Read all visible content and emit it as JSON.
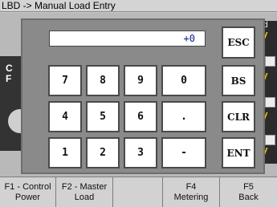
{
  "title_bar": {
    "breadcrumb": "LBD -> Manual Load Entry"
  },
  "background": {
    "left_label_1": "C",
    "left_label_2": "F",
    "right_top_char": "d"
  },
  "keypad": {
    "display_value": "+0",
    "rows": [
      [
        "7",
        "8",
        "9",
        "0"
      ],
      [
        "4",
        "5",
        "6",
        "."
      ],
      [
        "1",
        "2",
        "3",
        "-"
      ]
    ],
    "side_keys": [
      "ESC",
      "BS",
      "CLR",
      "ENT"
    ]
  },
  "function_keys": [
    {
      "key": "F1 - Control",
      "label": "Power"
    },
    {
      "key": "F2 - Master",
      "label": "Load"
    },
    {
      "key": "",
      "label": ""
    },
    {
      "key": "F4",
      "label": "Metering"
    },
    {
      "key": "F5",
      "label": "Back"
    }
  ],
  "colors": {
    "display_text": "#0b1a8f",
    "accent_yellow": "#f2c300",
    "dialog_bg": "#8a8a8a"
  }
}
